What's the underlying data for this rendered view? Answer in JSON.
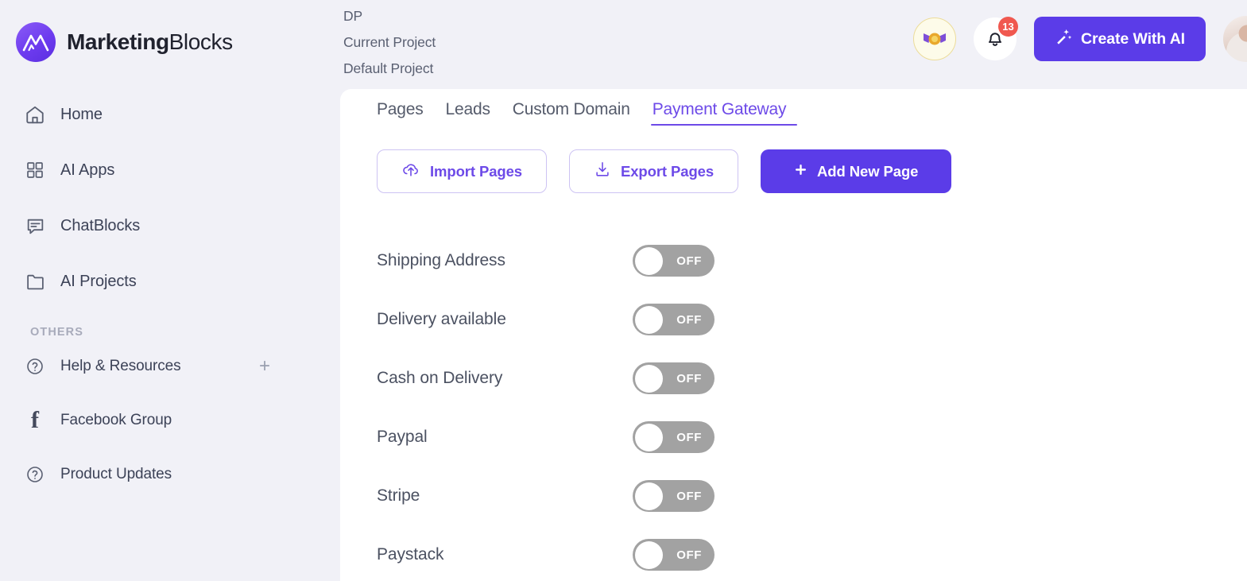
{
  "brand": {
    "name_bold": "Marketing",
    "name_light": "Blocks",
    "logo_icon": "mountain-m-logo"
  },
  "sidebar": {
    "items": [
      {
        "label": "Home",
        "icon": "home-icon"
      },
      {
        "label": "AI Apps",
        "icon": "grid-apps-icon"
      },
      {
        "label": "ChatBlocks",
        "icon": "chat-bubble-icon"
      },
      {
        "label": "AI Projects",
        "icon": "folder-icon"
      }
    ],
    "section_title": "OTHERS",
    "others": [
      {
        "label": "Help & Resources",
        "icon": "question-circle-icon",
        "action_icon": "plus-icon",
        "has_expand": true
      },
      {
        "label": "Facebook Group",
        "icon": "facebook-icon",
        "has_expand": false
      },
      {
        "label": "Product Updates",
        "icon": "question-circle-icon",
        "has_expand": false
      }
    ]
  },
  "header": {
    "project_lines": [
      "DP",
      "Current Project",
      "Default Project"
    ],
    "award_icon": "award-rosette-icon",
    "bell_icon": "bell-icon",
    "notification_count": "13",
    "create_button": {
      "label": "Create With AI",
      "icon": "magic-wand-icon"
    },
    "avatar_icon": "user-avatar"
  },
  "main": {
    "tabs": [
      {
        "label": "Pages",
        "active": false
      },
      {
        "label": "Leads",
        "active": false
      },
      {
        "label": "Custom Domain",
        "active": false
      },
      {
        "label": "Payment Gateway",
        "active": true
      }
    ],
    "actions": [
      {
        "label": "Import Pages",
        "icon": "cloud-upload-icon",
        "style": "outline"
      },
      {
        "label": "Export Pages",
        "icon": "download-icon",
        "style": "outline"
      },
      {
        "label": "Add New Page",
        "icon": "plus-icon",
        "style": "primary"
      }
    ],
    "settings": [
      {
        "label": "Shipping Address",
        "state": "OFF",
        "on": false
      },
      {
        "label": "Delivery available",
        "state": "OFF",
        "on": false
      },
      {
        "label": "Cash on Delivery",
        "state": "OFF",
        "on": false
      },
      {
        "label": "Paypal",
        "state": "OFF",
        "on": false
      },
      {
        "label": "Stripe",
        "state": "OFF",
        "on": false
      },
      {
        "label": "Paystack",
        "state": "OFF",
        "on": false
      }
    ]
  },
  "colors": {
    "accent": "#5b3ce8",
    "accent_text": "#6d4ae8",
    "page_bg": "#f1f1f7",
    "card_bg": "#ffffff",
    "toggle_off": "#a2a2a2",
    "badge_red": "#f0584f"
  }
}
